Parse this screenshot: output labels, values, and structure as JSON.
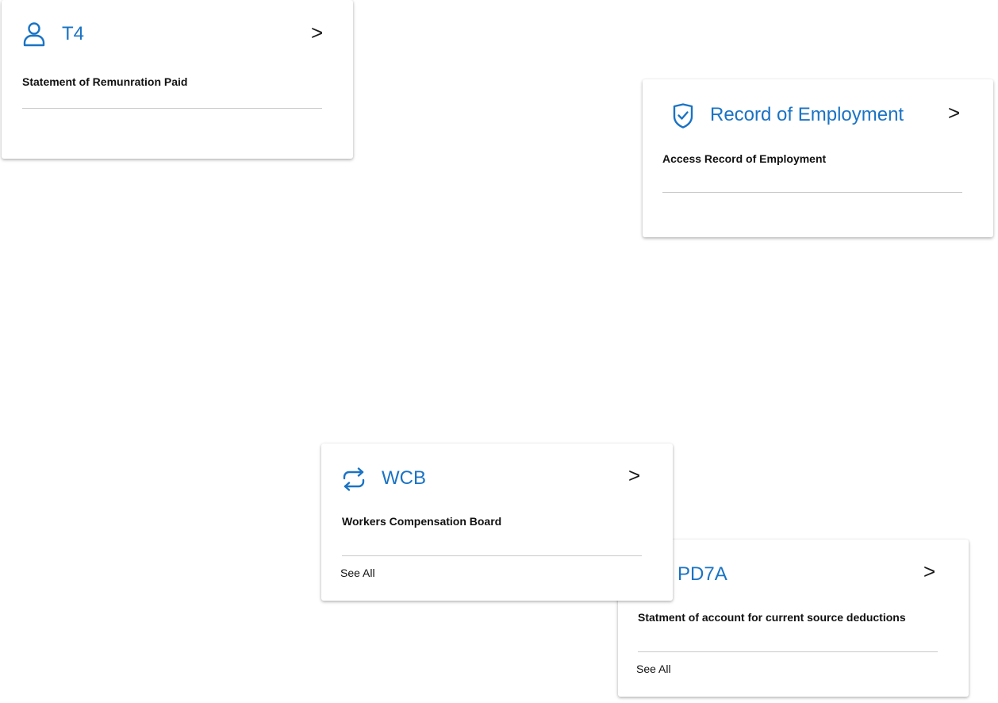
{
  "cards": {
    "t4": {
      "title": "T4",
      "description": "Statement of Remunration Paid",
      "arrow": ">",
      "icon": "person-icon"
    },
    "roe": {
      "title": "Record of Employment",
      "description": "Access Record of Employment",
      "arrow": ">",
      "icon": "shield-check-icon"
    },
    "wcb": {
      "title": "WCB",
      "description": "Workers Compensation Board",
      "arrow": ">",
      "link": "See All",
      "icon": "sync-arrows-icon"
    },
    "pd7a": {
      "title": "PD7A",
      "description": "Statment of account for current source deductions",
      "arrow": ">",
      "link": "See All"
    }
  },
  "colors": {
    "accent": "#1a73c4",
    "text": "#111111",
    "divider": "#c9c9c9"
  }
}
